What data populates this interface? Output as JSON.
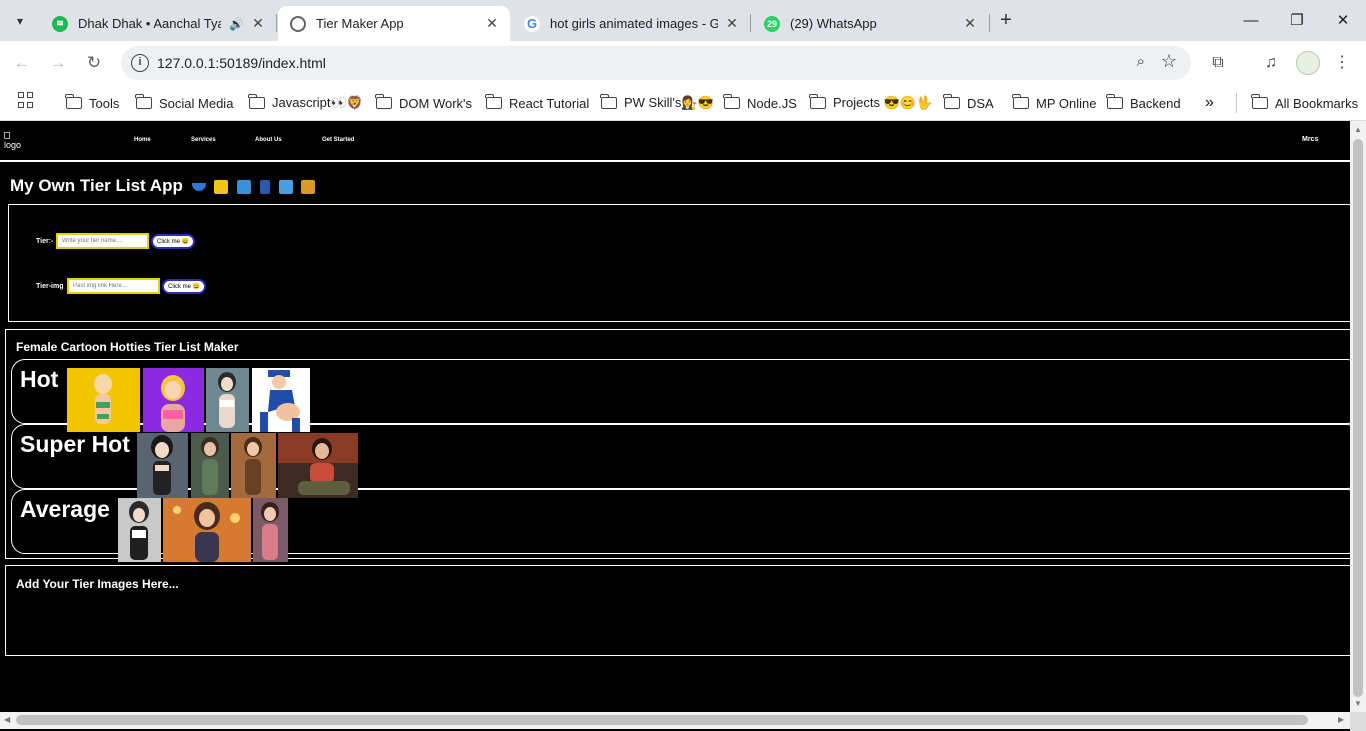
{
  "browser": {
    "tabs": [
      {
        "title": "Dhak Dhak • Aanchal Tyagi,",
        "favicon_color": "#1db954",
        "audio": true
      },
      {
        "title": "Tier Maker App",
        "favicon_color": "#5f6368",
        "active": true
      },
      {
        "title": "hot girls animated images - Go",
        "favicon_color": "#4285f4"
      },
      {
        "title": "(29) WhatsApp",
        "favicon_color": "#25d366",
        "badge": "29"
      }
    ],
    "url": "127.0.0.1:50189/index.html",
    "bookmarks": [
      "Tools",
      "Social Media",
      "Javascript👀🦁",
      "DOM Work's",
      "React Tutorial",
      "PW Skill's👩‍⚖️😎",
      "Node.JS",
      "Projects 😎😊🖖",
      "DSA",
      "MP Online",
      "Backend"
    ],
    "more_bookmarks": "»",
    "all_bookmarks": "All Bookmarks"
  },
  "site": {
    "logo_alt": "logo",
    "nav": [
      "Home",
      "Services",
      "About Us",
      "Get Started"
    ],
    "user": "Mrcs",
    "title": "My Own Tier List App",
    "title_emoji": [
      "swimwear",
      "shorts",
      "shirt",
      "jeans",
      "shopping-bags",
      "handbag"
    ],
    "form": {
      "tier_label": "Tier:-",
      "tier_placeholder": "Write your tier name....",
      "tier_button": "Click me 😀",
      "img_label": "Tier-img",
      "img_placeholder": "Past img link Here....",
      "img_button": "Click me 😀"
    },
    "tier_heading": "Female Cartoon Hotties Tier List Maker",
    "tiers": [
      {
        "name": "Hot",
        "image_count": 4
      },
      {
        "name": "Super Hot",
        "image_count": 4
      },
      {
        "name": "Average",
        "image_count": 3
      }
    ],
    "add_heading": "Add Your Tier Images Here..."
  }
}
